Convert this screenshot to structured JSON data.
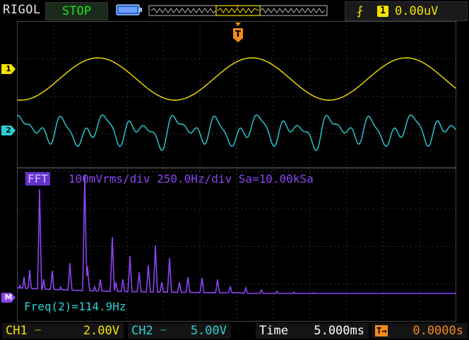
{
  "header": {
    "brand": "RIGOL",
    "run_state": "STOP",
    "trigger_channel": "1",
    "trigger_level": "0.00uV",
    "trigger_marker": "T"
  },
  "channel_markers": {
    "ch1": "1",
    "ch2": "2",
    "math": "M"
  },
  "fft": {
    "badge": "FFT",
    "scale": "100mVrms/div",
    "span": "250.0Hz/div",
    "sample_rate": "Sa=10.00kSa"
  },
  "measurement": "Freq(2)=114.9Hz",
  "footer": {
    "ch1_label": "CH1",
    "ch1_scale": "2.00V",
    "ch2_label": "CH2",
    "ch2_scale": "5.00V",
    "time_label": "Time",
    "time_scale": "5.000ms",
    "trigger_offset": "0.0000s"
  },
  "colors": {
    "ch1": "#f5e200",
    "ch2": "#2ad0d6",
    "math": "#8c44f2",
    "trigger": "#f08a1a",
    "run_state": "#19e619"
  },
  "icons": [
    "battery-icon",
    "rising-edge-icon",
    "trigger-marker-icon"
  ]
}
